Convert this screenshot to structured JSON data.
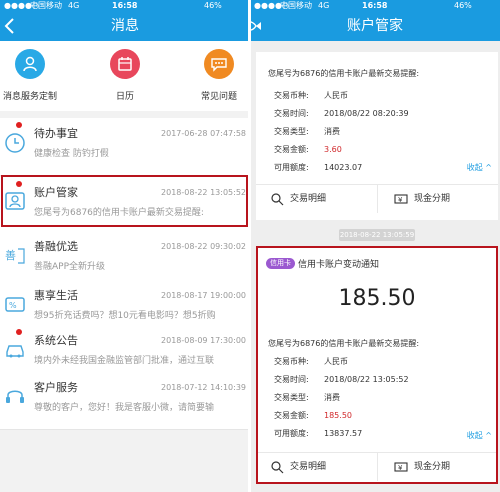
{
  "left": {
    "status": {
      "carrier": "中国移动",
      "net": "4G",
      "time": "16:58",
      "battery": "46%"
    },
    "nav": {
      "title": "消息"
    },
    "quick": [
      {
        "label": "消息服务定制",
        "icon": "user-service-icon",
        "color": "#29a9e6"
      },
      {
        "label": "日历",
        "icon": "calendar-icon",
        "color": "#e8475c"
      },
      {
        "label": "常见问题",
        "icon": "chat-question-icon",
        "color": "#f08a22"
      }
    ],
    "messages": [
      {
        "title": "待办事宜",
        "time": "2017-06-28 07:47:58",
        "sub": "健康检查 防钓打假",
        "icon": "clock-icon",
        "unread": true
      },
      {
        "title": "账户管家",
        "time": "2018-08-22 13:05:52",
        "sub": "您尾号为6876的信用卡账户最新交易提醒:",
        "icon": "account-keeper-icon",
        "unread": true
      },
      {
        "title": "善融优选",
        "time": "2018-08-22 09:30:02",
        "sub": "善融APP全新升级",
        "icon": "shanrong-icon",
        "unread": false
      },
      {
        "title": "惠享生活",
        "time": "2018-08-17 19:00:00",
        "sub": "想95折充话费吗？想10元看电影吗？想5折购",
        "icon": "discount-icon",
        "unread": false
      },
      {
        "title": "系统公告",
        "time": "2018-08-09 17:30:00",
        "sub": "境内外未经我国金融监管部门批准，通过互联",
        "icon": "car-notice-icon",
        "unread": true
      },
      {
        "title": "客户服务",
        "time": "2018-07-12 14:10:39",
        "sub": "尊敬的客户，您好！我是客服小微，请简要输",
        "icon": "headset-icon",
        "unread": false
      }
    ]
  },
  "right": {
    "status": {
      "carrier": "中国移动",
      "net": "4G",
      "time": "16:58",
      "battery": "46%"
    },
    "nav": {
      "title": "账户管家"
    },
    "card1": {
      "heading": "您尾号为6876的信用卡账户最新交易提醒:",
      "rows": [
        {
          "k": "交易币种:",
          "v": "人民币"
        },
        {
          "k": "交易时间:",
          "v": "2018/08/22 08:20:39"
        },
        {
          "k": "交易类型:",
          "v": "消费"
        },
        {
          "k": "交易金额:",
          "v": "3.60"
        },
        {
          "k": "可用额度:",
          "v": "14023.07"
        }
      ],
      "collapse": "收起 ^",
      "btn_detail": "交易明细",
      "btn_installment": "现金分期"
    },
    "timestamp": "2018-08-22 13:05:59",
    "card2": {
      "badge": "信用卡",
      "title": "信用卡账户变动通知",
      "amount": "185.50",
      "heading": "您尾号为6876的信用卡账户最新交易提醒:",
      "rows": [
        {
          "k": "交易币种:",
          "v": "人民币"
        },
        {
          "k": "交易时间:",
          "v": "2018/08/22 13:05:52"
        },
        {
          "k": "交易类型:",
          "v": "消费"
        },
        {
          "k": "交易金额:",
          "v": "185.50"
        },
        {
          "k": "可用额度:",
          "v": "13837.57"
        }
      ],
      "collapse": "收起 ^",
      "btn_detail": "交易明细",
      "btn_installment": "现金分期"
    }
  }
}
